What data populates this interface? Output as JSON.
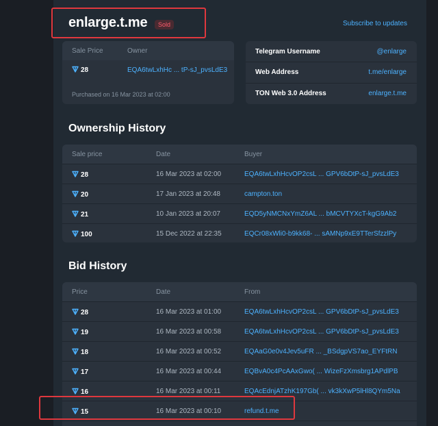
{
  "header": {
    "title": "enlarge.t.me",
    "badge": "Sold",
    "subscribe_link": "Subscribe to updates"
  },
  "sale": {
    "price_label": "Sale Price",
    "owner_label": "Owner",
    "price": "28",
    "owner": "EQA6twLxhHc ... tP-sJ_pvsLdE3",
    "purchased": "Purchased on 16 Mar 2023 at 02:00"
  },
  "info": {
    "rows": [
      {
        "label": "Telegram Username",
        "value": "@enlarge"
      },
      {
        "label": "Web Address",
        "value": "t.me/enlarge"
      },
      {
        "label": "TON Web 3.0 Address",
        "value": "enlarge.t.me"
      }
    ]
  },
  "ownership": {
    "title": "Ownership History",
    "columns": [
      "Sale price",
      "Date",
      "Buyer"
    ],
    "rows": [
      {
        "price": "28",
        "date": "16 Mar 2023 at 02:00",
        "addr": "EQA6twLxhHcvOP2csL ... GPV6bDtP-sJ_pvsLdE3"
      },
      {
        "price": "20",
        "date": "17 Jan 2023 at 20:48",
        "addr": "campton.ton"
      },
      {
        "price": "21",
        "date": "10 Jan 2023 at 20:07",
        "addr": "EQD5yNMCNxYmZ6AL ... bMCVTYXcT-kgG9Ab2"
      },
      {
        "price": "100",
        "date": "15 Dec 2022 at 22:35",
        "addr": "EQCr08xWli0-b9kk68- ... sAMNp9xE9TTerSfzzlPy"
      }
    ]
  },
  "bids": {
    "title": "Bid History",
    "columns": [
      "Price",
      "Date",
      "From"
    ],
    "rows": [
      {
        "price": "28",
        "date": "16 Mar 2023 at 01:00",
        "addr": "EQA6twLxhHcvOP2csL ... GPV6bDtP-sJ_pvsLdE3"
      },
      {
        "price": "19",
        "date": "16 Mar 2023 at 00:58",
        "addr": "EQA6twLxhHcvOP2csL ... GPV6bDtP-sJ_pvsLdE3"
      },
      {
        "price": "18",
        "date": "16 Mar 2023 at 00:52",
        "addr": "EQAaG0e0v4Jev5uFR ... _BSdgpVS7ao_EYFtRN"
      },
      {
        "price": "17",
        "date": "16 Mar 2023 at 00:44",
        "addr": "EQBvA0c4PcAAxGwo( ... WizeFzXmsbrg1APdlPB"
      },
      {
        "price": "16",
        "date": "16 Mar 2023 at 00:11",
        "addr": "EQAcEdnjATzhK197Gb( ... vk3kXwP5lHl8QYm5Na"
      },
      {
        "price": "15",
        "date": "16 Mar 2023 at 00:10",
        "addr": "refund.t.me"
      }
    ]
  },
  "colors": {
    "accent": "#4db2ff",
    "sold": "#ff5c6c",
    "highlight": "#e0383e"
  },
  "icons": {
    "ton": "ton-diamond-icon"
  }
}
